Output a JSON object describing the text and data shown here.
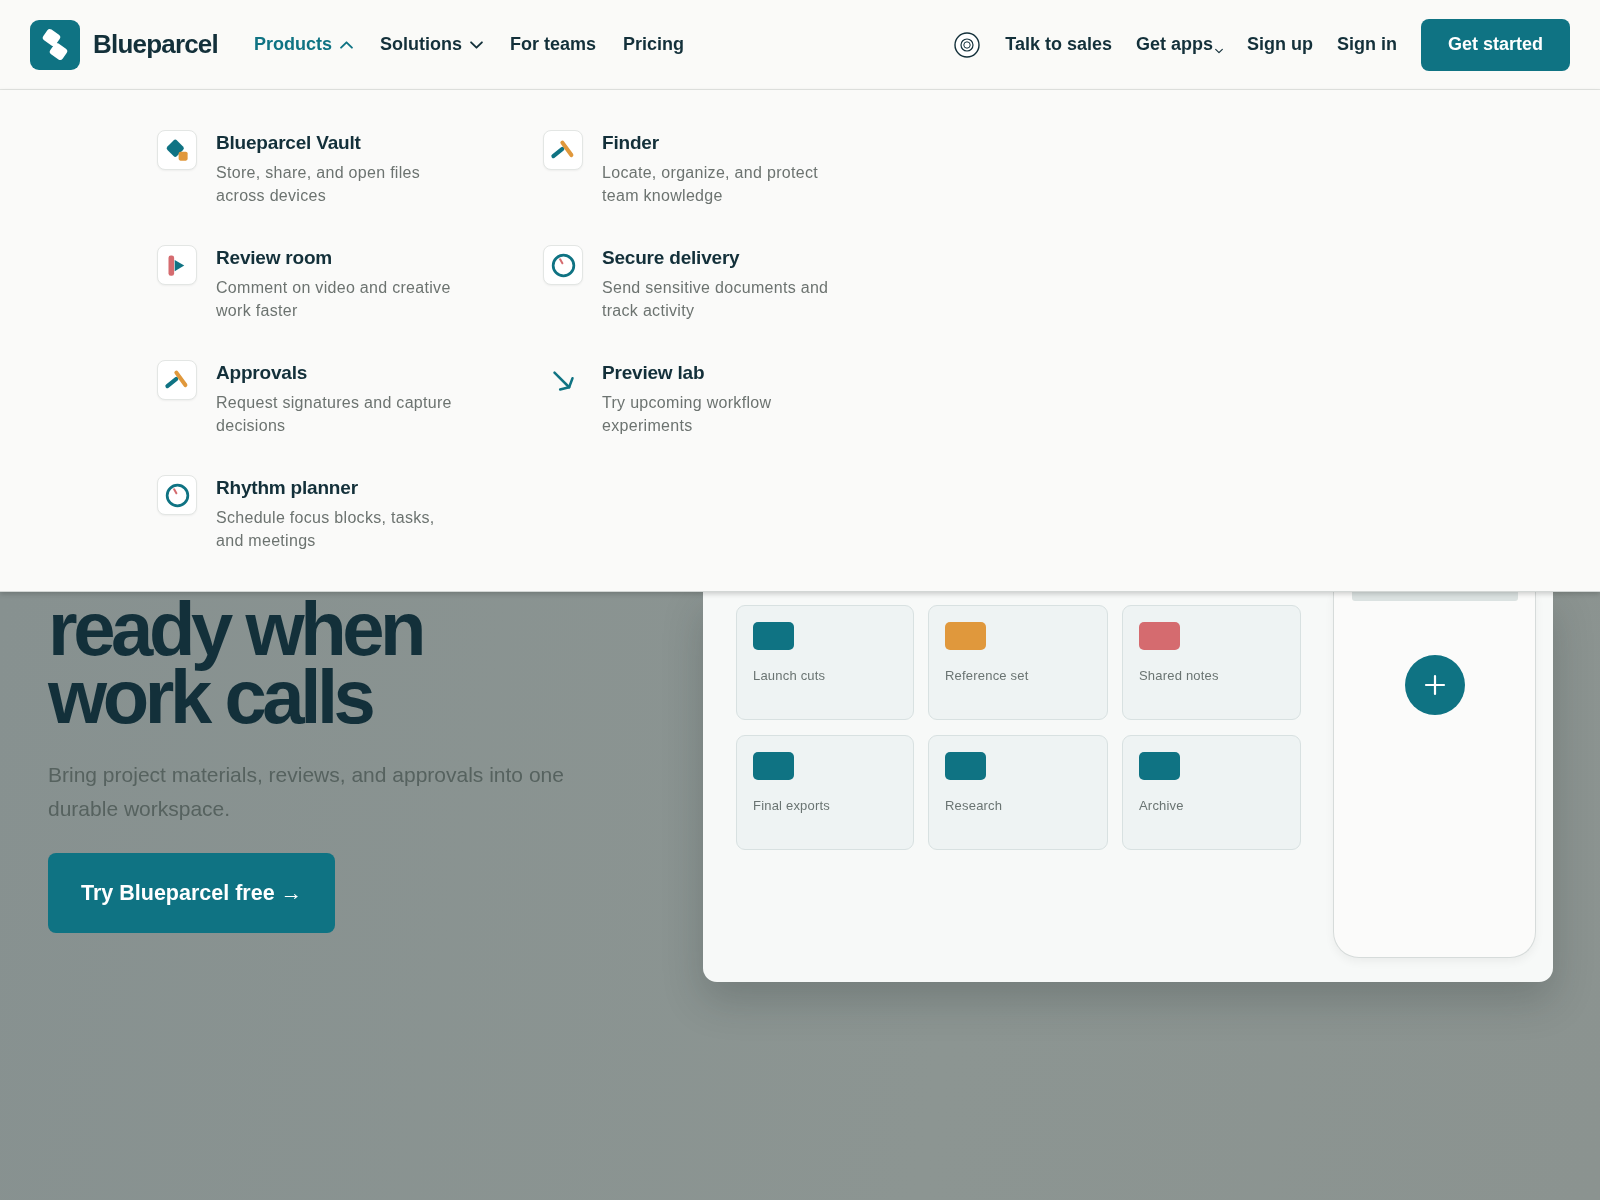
{
  "navbar": {
    "brand": "Blueparcel",
    "menu": [
      {
        "label": "Products",
        "kind": "dropdown",
        "selected": true,
        "expanded": true
      },
      {
        "label": "Solutions",
        "kind": "dropdown",
        "selected": false,
        "expanded": false
      },
      {
        "label": "For teams",
        "kind": "link",
        "selected": false
      },
      {
        "label": "Pricing",
        "kind": "link",
        "selected": false
      }
    ],
    "actions": [
      {
        "label": "Talk to sales",
        "kind": "link"
      },
      {
        "label": "Get apps",
        "kind": "dropdown",
        "expanded": false
      },
      {
        "label": "Sign up",
        "kind": "link"
      },
      {
        "label": "Sign in",
        "kind": "link"
      }
    ],
    "cta": "Get started"
  },
  "products_menu": {
    "items": [
      {
        "title": "Blueparcel Vault",
        "description": "Store, share, and open files across devices",
        "kind": "diamond",
        "framed": true
      },
      {
        "title": "Finder",
        "description": "Locate, organize, and protect team knowledge",
        "kind": "tool",
        "framed": true
      },
      {
        "title": "Review room",
        "description": "Comment on video and creative work faster",
        "kind": "play",
        "framed": true
      },
      {
        "title": "Secure delivery",
        "description": "Send sensitive documents and track activity",
        "kind": "dial",
        "framed": true
      },
      {
        "title": "Approvals",
        "description": "Request signatures and capture decisions",
        "kind": "tool",
        "framed": true
      },
      {
        "title": "Preview lab",
        "description": "Try upcoming workflow experiments",
        "kind": "arrow",
        "framed": false
      },
      {
        "title": "Rhythm planner",
        "description": "Schedule focus blocks, tasks, and meetings",
        "kind": "dial",
        "framed": true
      }
    ]
  },
  "hero": {
    "heading": "ready when work calls",
    "text": "Bring project materials, reviews, and approvals into one durable workspace.",
    "button": "Try Blueparcel free →",
    "preview": {
      "cards": [
        {
          "label": "Launch cuts",
          "color": "#0f7383"
        },
        {
          "label": "Reference set",
          "color": "#e0983c"
        },
        {
          "label": "Shared notes",
          "color": "#d56b6f"
        },
        {
          "label": "Final exports",
          "color": "#0f7383"
        },
        {
          "label": "Research",
          "color": "#0f7383"
        },
        {
          "label": "Archive",
          "color": "#0f7383"
        }
      ]
    }
  }
}
